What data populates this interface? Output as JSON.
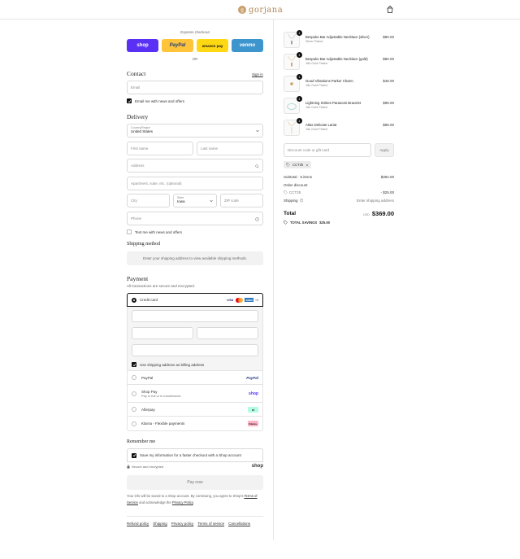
{
  "header": {
    "brand": "gorjana",
    "brand_mark": "g",
    "bag_icon": "shopping-bag-icon"
  },
  "express": {
    "label": "Express checkout",
    "buttons": [
      {
        "label": "shop",
        "color": "#5a31f4",
        "text_color": "#ffffff"
      },
      {
        "label": "PayPal",
        "color": "#ffc439",
        "text_color": "#253b80"
      },
      {
        "label": "amazon pay",
        "color": "#ffd814",
        "text_color": "#111111"
      },
      {
        "label": "venmo",
        "color": "#3d95ce",
        "text_color": "#ffffff"
      }
    ],
    "or": "OR"
  },
  "contact": {
    "title": "Contact",
    "sign_in": "Sign in",
    "email_placeholder": "Email",
    "newsletter": "Email me with news and offers"
  },
  "delivery": {
    "title": "Delivery",
    "country_label": "Country/Region",
    "country_value": "United States",
    "first_name": "First name",
    "last_name": "Last name",
    "address": "Address",
    "apartment": "Apartment, suite, etc. (optional)",
    "city": "City",
    "state_label": "State",
    "state_value": "Iowa",
    "zip": "ZIP code",
    "phone": "Phone",
    "text_me": "Text me with news and offers"
  },
  "shipping": {
    "title": "Shipping method",
    "note": "Enter your shipping address to view available shipping methods."
  },
  "payment": {
    "title": "Payment",
    "subtitle": "All transactions are secure and encrypted.",
    "credit_card": "Credit card",
    "card_badges": [
      "VISA",
      "MC",
      "AMEX",
      "+4"
    ],
    "billing_same": "Use shipping address as billing address",
    "methods": [
      {
        "label": "PayPal",
        "sub": "",
        "badge": "PayPal",
        "badge_color": "#253b80"
      },
      {
        "label": "Shop Pay",
        "sub": "Pay in full or in installments",
        "badge": "shop",
        "badge_color": "#5a31f4"
      },
      {
        "label": "Afterpay",
        "sub": "",
        "badge": "⇄",
        "badge_color": "#b2fce4"
      },
      {
        "label": "Klarna - Flexible payments",
        "sub": "",
        "badge": "Klarna.",
        "badge_color": "#ffb3c7"
      }
    ]
  },
  "remember": {
    "title": "Remember me",
    "save": "Save my information for a faster checkout with a Shop account",
    "secure": "Secure and encrypted",
    "shop_logo": "shop"
  },
  "pay_now": "Pay now",
  "legal": {
    "text1": "Your info will be saved to a Shop account. By continuing, you agree to Shop's ",
    "terms": "Terms of Service",
    "text2": " and acknowledge the ",
    "privacy": "Privacy Policy",
    "text3": "."
  },
  "footer": [
    "Refund policy",
    "Shipping",
    "Privacy policy",
    "Terms of service",
    "Cancellations"
  ],
  "cart": {
    "items": [
      {
        "name": "Bespoke Bar Adjustable Necklace (silver)",
        "variant": "Silver Plated",
        "price": "$80.00",
        "qty": "1"
      },
      {
        "name": "Bespoke Bar Adjustable Necklace (gold)",
        "variant": "18k Gold Plated",
        "price": "$80.00",
        "qty": "1"
      },
      {
        "name": "Good Vibrations Parker Charm",
        "variant": "18k Gold Plated",
        "price": "$48.00",
        "qty": "1"
      },
      {
        "name": "Lightning Strikes Parasomi Bracelet",
        "variant": "18k Gold Plated",
        "price": "$98.00",
        "qty": "1"
      },
      {
        "name": "Atlas Delicate Lariat",
        "variant": "18k Gold Plated",
        "price": "$88.00",
        "qty": "1"
      }
    ],
    "discount_placeholder": "Discount code or gift card",
    "apply": "Apply",
    "code": "CCT25",
    "subtotal_label": "Subtotal · 5 items",
    "subtotal": "$394.00",
    "order_discount": "Order discount",
    "discount_code": "CCT25",
    "discount_amount": "- $25.00",
    "shipping_label": "Shipping",
    "shipping_value": "Enter shipping address",
    "total_label": "Total",
    "currency": "USD",
    "total": "$369.00",
    "savings_label": "TOTAL SAVINGS",
    "savings": "$25.00"
  }
}
